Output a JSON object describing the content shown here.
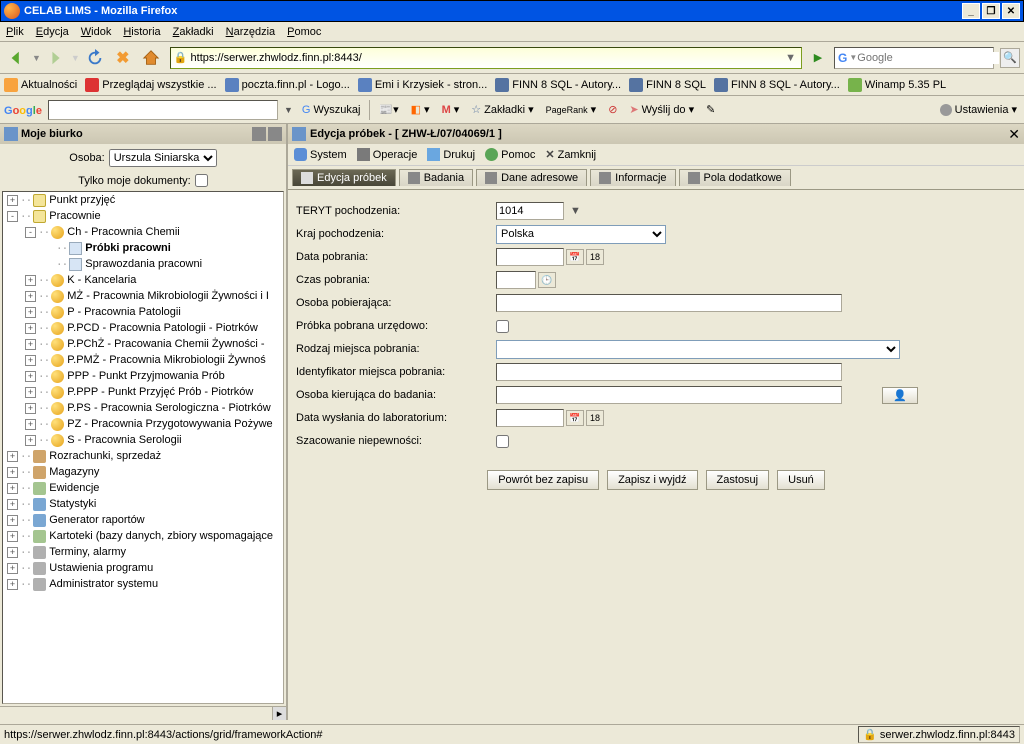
{
  "window": {
    "title": "CELAB LIMS - Mozilla Firefox"
  },
  "menubar": [
    "Plik",
    "Edycja",
    "Widok",
    "Historia",
    "Zakładki",
    "Narzędzia",
    "Pomoc"
  ],
  "navbar": {
    "url": "https://serwer.zhwlodz.finn.pl:8443/",
    "search_placeholder": "Google"
  },
  "bookmarkbar": [
    "Aktualności",
    "Przeglądaj wszystkie ...",
    "poczta.finn.pl - Logo...",
    "Emi i Krzysiek - stron...",
    "FINN 8 SQL - Autory...",
    "FINN 8 SQL",
    "FINN 8 SQL - Autory...",
    "Winamp 5.35 PL"
  ],
  "googlebar": {
    "logo": "Google",
    "wyszukaj": "Wyszukaj",
    "zakladki": "Zakładki",
    "pagerank": "PageRank",
    "wyslij": "Wyślij do",
    "ustawienia": "Ustawienia"
  },
  "sidebar": {
    "title": "Moje biurko",
    "osoba_label": "Osoba:",
    "osoba_value": "Urszula Siniarska",
    "tylko_label": "Tylko moje dokumenty:"
  },
  "tree": [
    {
      "ind": 0,
      "exp": "+",
      "ico": "folder",
      "txt": "Punkt przyjęć"
    },
    {
      "ind": 0,
      "exp": "-",
      "ico": "folder",
      "txt": "Pracownie"
    },
    {
      "ind": 1,
      "exp": "-",
      "ico": "ball",
      "txt": "Ch - Pracownia Chemii"
    },
    {
      "ind": 2,
      "exp": "",
      "ico": "doc",
      "txt": "Próbki pracowni",
      "bold": true
    },
    {
      "ind": 2,
      "exp": "",
      "ico": "doc",
      "txt": "Sprawozdania pracowni"
    },
    {
      "ind": 1,
      "exp": "+",
      "ico": "ball",
      "txt": "K - Kancelaria"
    },
    {
      "ind": 1,
      "exp": "+",
      "ico": "ball",
      "txt": "MŻ - Pracownia Mikrobiologii Żywności i I"
    },
    {
      "ind": 1,
      "exp": "+",
      "ico": "ball",
      "txt": "P - Pracownia Patologii"
    },
    {
      "ind": 1,
      "exp": "+",
      "ico": "ball",
      "txt": "P.PCD - Pracownia Patologii - Piotrków"
    },
    {
      "ind": 1,
      "exp": "+",
      "ico": "ball",
      "txt": "P.PChŻ - Pracowania Chemii Żywności -"
    },
    {
      "ind": 1,
      "exp": "+",
      "ico": "ball",
      "txt": "P.PMŻ - Pracownia Mikrobiologii Żywnoś"
    },
    {
      "ind": 1,
      "exp": "+",
      "ico": "ball",
      "txt": "PPP - Punkt Przyjmowania Prób"
    },
    {
      "ind": 1,
      "exp": "+",
      "ico": "ball",
      "txt": "P.PPP - Punkt Przyjęć Prób - Piotrków"
    },
    {
      "ind": 1,
      "exp": "+",
      "ico": "ball",
      "txt": "P.PS - Pracownia Serologiczna - Piotrków"
    },
    {
      "ind": 1,
      "exp": "+",
      "ico": "ball",
      "txt": "PZ - Pracownia Przygotowywania Pożywe"
    },
    {
      "ind": 1,
      "exp": "+",
      "ico": "ball",
      "txt": "S - Pracownia Serologii"
    },
    {
      "ind": 0,
      "exp": "+",
      "ico": "box",
      "txt": "Rozrachunki, sprzedaż"
    },
    {
      "ind": 0,
      "exp": "+",
      "ico": "box",
      "txt": "Magazyny"
    },
    {
      "ind": 0,
      "exp": "+",
      "ico": "db",
      "txt": "Ewidencje"
    },
    {
      "ind": 0,
      "exp": "+",
      "ico": "chart",
      "txt": "Statystyki"
    },
    {
      "ind": 0,
      "exp": "+",
      "ico": "chart",
      "txt": "Generator raportów"
    },
    {
      "ind": 0,
      "exp": "+",
      "ico": "db",
      "txt": "Kartoteki (bazy danych, zbiory wspomagające"
    },
    {
      "ind": 0,
      "exp": "+",
      "ico": "cog",
      "txt": "Terminy, alarmy"
    },
    {
      "ind": 0,
      "exp": "+",
      "ico": "cog",
      "txt": "Ustawienia programu"
    },
    {
      "ind": 0,
      "exp": "+",
      "ico": "cog",
      "txt": "Administrator systemu"
    }
  ],
  "main": {
    "title": "Edycja próbek - [ ZHW-Ł/07/04069/1 ]",
    "menu": [
      {
        "n": "system",
        "l": "System"
      },
      {
        "n": "operacje",
        "l": "Operacje"
      },
      {
        "n": "drukuj",
        "l": "Drukuj"
      },
      {
        "n": "pomoc",
        "l": "Pomoc"
      },
      {
        "n": "zamknij",
        "l": "Zamknij"
      }
    ],
    "tabs": [
      {
        "l": "Edycja próbek",
        "a": true
      },
      {
        "l": "Badania"
      },
      {
        "l": "Dane adresowe"
      },
      {
        "l": "Informacje"
      },
      {
        "l": "Pola dodatkowe"
      }
    ],
    "fields": {
      "teryt": {
        "lbl": "TERYT pochodzenia:",
        "val": "1014"
      },
      "kraj": {
        "lbl": "Kraj pochodzenia:",
        "val": "Polska"
      },
      "data_pob": {
        "lbl": "Data pobrania:"
      },
      "czas_pob": {
        "lbl": "Czas pobrania:"
      },
      "osoba_pob": {
        "lbl": "Osoba pobierająca:"
      },
      "urzed": {
        "lbl": "Próbka pobrana urzędowo:"
      },
      "rodzaj": {
        "lbl": "Rodzaj miejsca pobrania:"
      },
      "ident": {
        "lbl": "Identyfikator miejsca pobrania:"
      },
      "osoba_kier": {
        "lbl": "Osoba kierująca do badania:"
      },
      "data_wys": {
        "lbl": "Data wysłania do laboratorium:"
      },
      "szac": {
        "lbl": "Szacowanie niepewności:"
      }
    },
    "buttons": {
      "powrot": "Powrót bez zapisu",
      "zapisz": "Zapisz i wyjdź",
      "zastosuj": "Zastosuj",
      "usun": "Usuń"
    }
  },
  "status": {
    "left": "https://serwer.zhwlodz.finn.pl:8443/actions/grid/frameworkAction#",
    "right": "serwer.zhwlodz.finn.pl:8443"
  }
}
